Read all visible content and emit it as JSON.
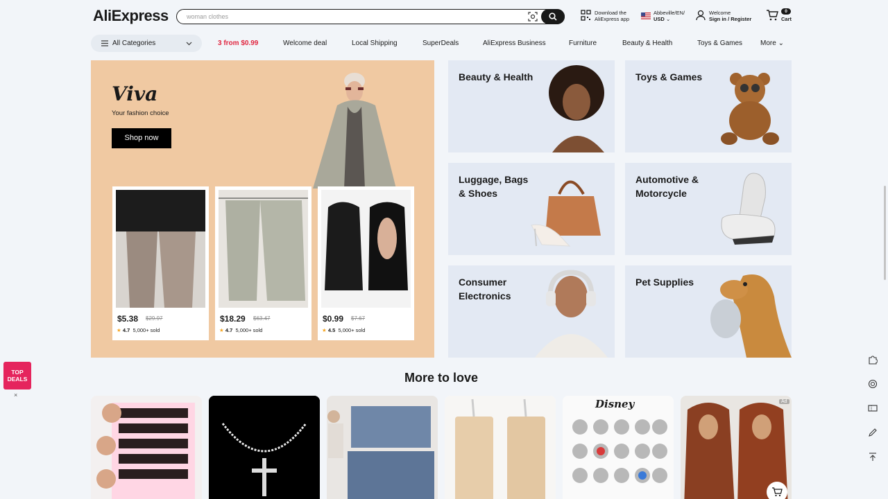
{
  "header": {
    "logo_part1": "Ali",
    "logo_part2": "Express",
    "search_placeholder": "woman clothes",
    "app_line1": "Download the",
    "app_line2": "AliExpress app",
    "locale_line1": "Abbeville/EN/",
    "locale_line2": "USD",
    "account_line1": "Welcome",
    "account_line2": "Sign in / Register",
    "cart_count": "0",
    "cart_label": "Cart"
  },
  "nav": {
    "all_categories": "All Categories",
    "links": [
      "3 from $0.99",
      "Welcome deal",
      "Local Shipping",
      "SuperDeals",
      "AliExpress Business",
      "Furniture",
      "Beauty & Health",
      "Toys & Games",
      "More"
    ]
  },
  "hero": {
    "title": "Viva",
    "subtitle": "Your fashion choice",
    "cta": "Shop now",
    "products": [
      {
        "price": "$5.38",
        "orig": "$29.97",
        "rating": "4.7",
        "sold": "5,000+ sold"
      },
      {
        "price": "$18.29",
        "orig": "$63.47",
        "rating": "4.7",
        "sold": "5,000+ sold"
      },
      {
        "price": "$0.99",
        "orig": "$7.67",
        "rating": "4.5",
        "sold": "5,000+ sold"
      }
    ]
  },
  "categories": [
    {
      "label": "Beauty & Health"
    },
    {
      "label": "Toys & Games"
    },
    {
      "label": "Luggage, Bags & Shoes"
    },
    {
      "label": "Automotive & Motorcycle"
    },
    {
      "label": "Consumer Electronics"
    },
    {
      "label": "Pet Supplies"
    }
  ],
  "more_to_love": {
    "title": "More to love",
    "ad_label": "Ad",
    "brand_label": "Disney"
  },
  "side": {
    "top_deals_line1": "TOP",
    "top_deals_line2": "DEALS",
    "close": "×"
  },
  "colors": {
    "accent": "#fd384f",
    "hero_bg": "#f0c9a2",
    "tile_bg": "#e3e9f3",
    "page_bg": "#f2f5f9"
  }
}
